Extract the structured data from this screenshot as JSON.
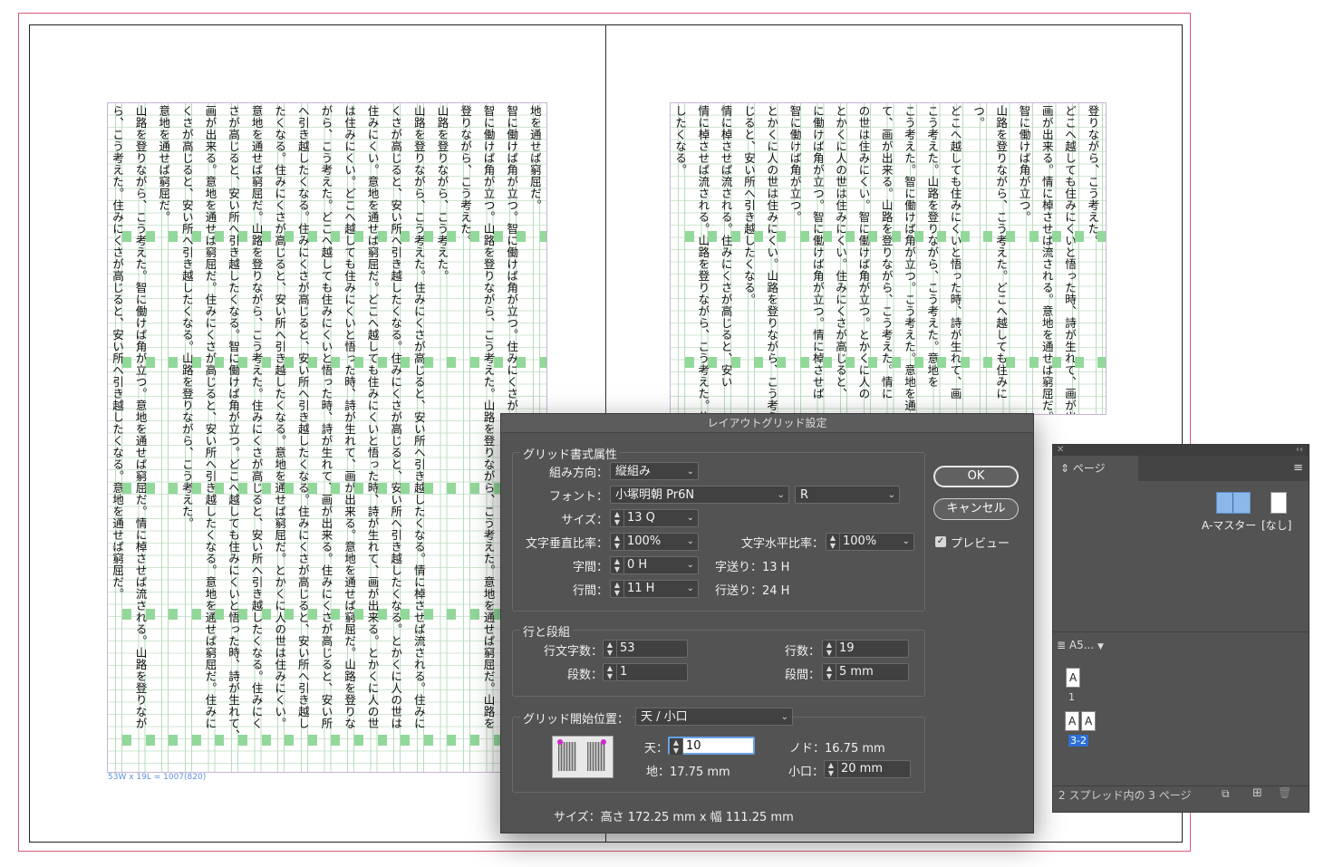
{
  "document": {
    "left_columns": [
      "ら、こう考えた。住みにくさが高じると、安い所へ引き越したくなる。意地を通せば窮屈だ。",
      "山路を登りながら、こう考えた。智に働けば角が立つ。意地を通せば窮屈だ。情に棹させば流される。山路を登りなが",
      "意地を通せば窮屈だ。",
      "くさが高じると、安い所へ引き越したくなる。山路を登りながら、こう考えた。",
      "画が出来る。意地を通せば窮屈だ。住みにくさが高じると、安い所へ引き越したくなる。意地を通せば窮屈だ。住みに",
      "さが高じると、安い所へ引き越したくなる。智に働けば角が立つ。どこへ越しても住みにくいと悟った時、詩が生れて、",
      "意地を通せば窮屈だ。山路を登りながら、こう考えた。住みにくさが高じると、安い所へ引き越したくなる。住みにく",
      "たくなる。住みにくさが高じると、安い所へ引き越したくなる。意地を通せば窮屈だ。とかくに人の世は住みにくい。",
      "へ引き越したくなる。住みにくさが高じると、安い所へ引き越したくなる。住みにくさが高じると、安い所へ引き越し",
      "がら、こう考えた。どこへ越しても住みにくいと悟った時、詩が生れて、画が出来る。住みにくさが高じると、安い所",
      "は住みにくい。どこへ越しても住みにくいと悟った時、詩が生れて、画が出来る。意地を通せば窮屈だ。山路を登りな",
      "住みにくい。意地を通せば窮屈だ。どこへ越しても住みにくいと悟った時、詩が生れて、画が出来る。とかくに人の世",
      "くさが高じると、安い所へ引き越したくなる。住みにくさが高じると、安い所へ引き越したくなる。とかくに人の世は",
      "山路を登りながら、こう考えた。住みにくさが高じると、安い所へ引き越したくなる。情に棹させば流される。住みに",
      "山路を登りながら、こう考えた。",
      "登りながら、こう考えた。",
      "智に働けば角が立つ。山路を登りながら、こう考えた。山路を登りながら、こう考えた。意地を通せば窮屈だ。山路を",
      "智に働けば角が立つ。智に働けば角が立つ。住みにくさが",
      "地を通せば窮屈だ。"
    ],
    "right_columns": [
      "したくなる。",
      "情に棹させば流される。山路を登りながら、こう考えた。住みにく",
      "情に棹させば流される。住みにくさが高じると、安い",
      "じると、安い所へ引き越したくなる。",
      "とかくに人の世は住みにくい。山路を登りながら、こう考え",
      "智に働けば角が立つ。",
      "に働けば角が立つ。智に働けば角が立つ。情に棹させば",
      "とかくに人の世は住みにくい。住みにくさが高じると、",
      "の世は住みにくい。智に働けば角が立つ。とかくに人の",
      "て、画が出来る。山路を登りながら、こう考えた。情に",
      "こう考えた。智に働けば角が立つ。こう考えた。意地を通",
      "こう考えた。山路を登りながら、こう考えた。意地を",
      "どこへ越しても住みにくいと悟った時、詩が生れて、画",
      "つ。",
      "山路を登りながら、こう考えた。どこへ越しても住みに",
      "智に働けば角が立つ。",
      "画が出来る。情に棹させば流される。意地を通せば窮屈だ。",
      "どこへ越しても住みにくいと悟った時、詩が生れて、画が出",
      "登りながら、こう考えた。"
    ],
    "frame_info": "53W x 19L = 1007(820)"
  },
  "dialog": {
    "title": "レイアウトグリッド設定",
    "group_format": "グリッド書式属性",
    "direction_label": "組み方向：",
    "direction_value": "縦組み",
    "font_label": "フォント：",
    "font_value": "小塚明朝 Pr6N",
    "font_style_value": "R",
    "size_label": "サイズ：",
    "size_value": "13 Q",
    "vscale_label": "文字垂直比率：",
    "vscale_value": "100%",
    "hscale_label": "文字水平比率：",
    "hscale_value": "100%",
    "char_gap_label": "字間：",
    "char_gap_value": "0 H",
    "char_pitch": "字送り：13 H",
    "line_gap_label": "行間：",
    "line_gap_value": "11 H",
    "line_pitch": "行送り：24 H",
    "group_lines": "行と段組",
    "chars_per_line_label": "行文字数：",
    "chars_per_line_value": "53",
    "lines_label": "行数：",
    "lines_value": "19",
    "columns_label": "段数：",
    "columns_value": "1",
    "gutter_label": "段間：",
    "gutter_value": "5 mm",
    "start_label": "グリッド開始位置：",
    "start_value": "天 / 小口",
    "top_label": "天：",
    "top_value": "10",
    "bottom_info": "地：17.75 mm",
    "inside_info": "ノド：16.75 mm",
    "outside_label": "小口：",
    "outside_value": "20 mm",
    "size_info": "サイズ：高さ 172.25 mm x 幅 111.25 mm",
    "ok_label": "OK",
    "cancel_label": "キャンセル",
    "preview_label": "プレビュー",
    "preview_checked": true
  },
  "pages_panel": {
    "tab_label": "ページ",
    "master_label": "A-マスター",
    "none_label": "[なし]",
    "size_dropdown": "A5...",
    "page1_letter": "A",
    "page1_number": "1",
    "page2_letter": "A",
    "page3_letter": "A",
    "spread2_number": "3-2",
    "status": "2 スプレッド内の 3 ページ"
  },
  "colors": {
    "bleed": "#d85a74",
    "grid_highlight": "#92d89a",
    "dialog_bg": "#535353",
    "selected_page": "#2d6fd6"
  }
}
